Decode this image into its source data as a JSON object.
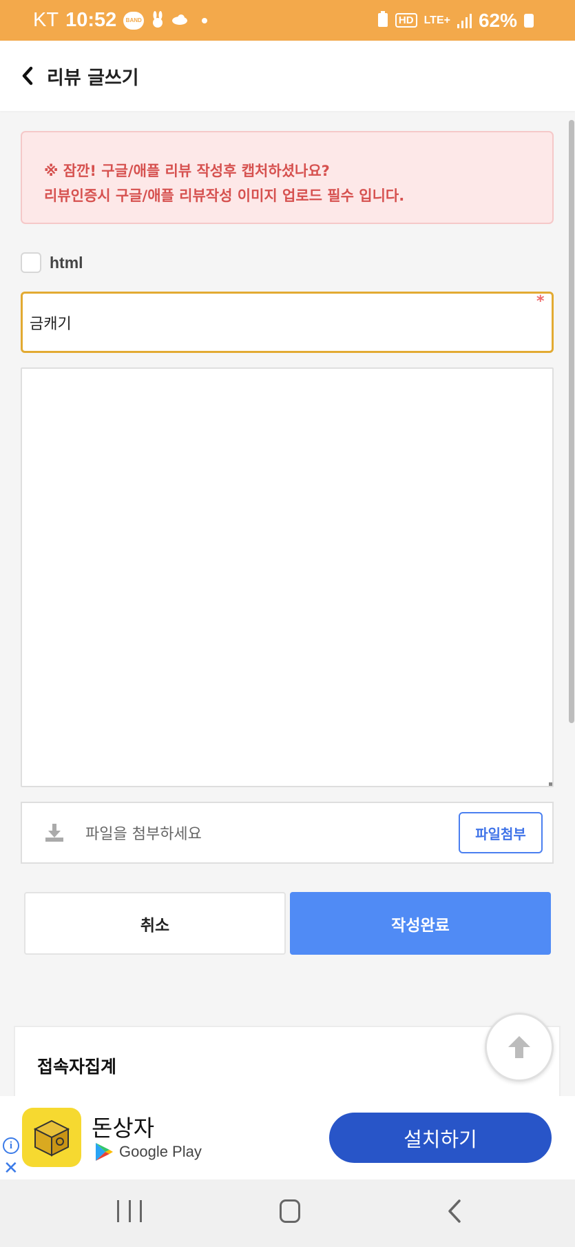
{
  "status_bar": {
    "carrier": "KT",
    "time": "10:52",
    "band_label": "BAND",
    "hd_label": "HD",
    "network": "LTE+",
    "battery": "62%"
  },
  "header": {
    "title": "리뷰 글쓰기"
  },
  "notice": {
    "line1": "※ 잠깐! 구글/애플 리뷰 작성후 캡처하셨나요?",
    "line2": "리뷰인증시 구글/애플 리뷰작성 이미지 업로드 필수 입니다."
  },
  "form": {
    "html_label": "html",
    "title_value": "금캐기",
    "required_mark": "*",
    "content_value": ""
  },
  "file": {
    "placeholder": "파일을 첨부하세요",
    "attach_label": "파일첨부"
  },
  "actions": {
    "cancel_label": "취소",
    "submit_label": "작성완료"
  },
  "visitor": {
    "title": "접속자집계"
  },
  "ad": {
    "app_name": "돈상자",
    "store": "Google Play",
    "install_label": "설치하기",
    "info_label": "i",
    "close_label": "✕"
  },
  "colors": {
    "status_bar": "#f3a94b",
    "accent_blue": "#508bf5",
    "notice_text": "#d6514f",
    "title_border": "#e2aa32",
    "ad_button": "#2855c8"
  }
}
